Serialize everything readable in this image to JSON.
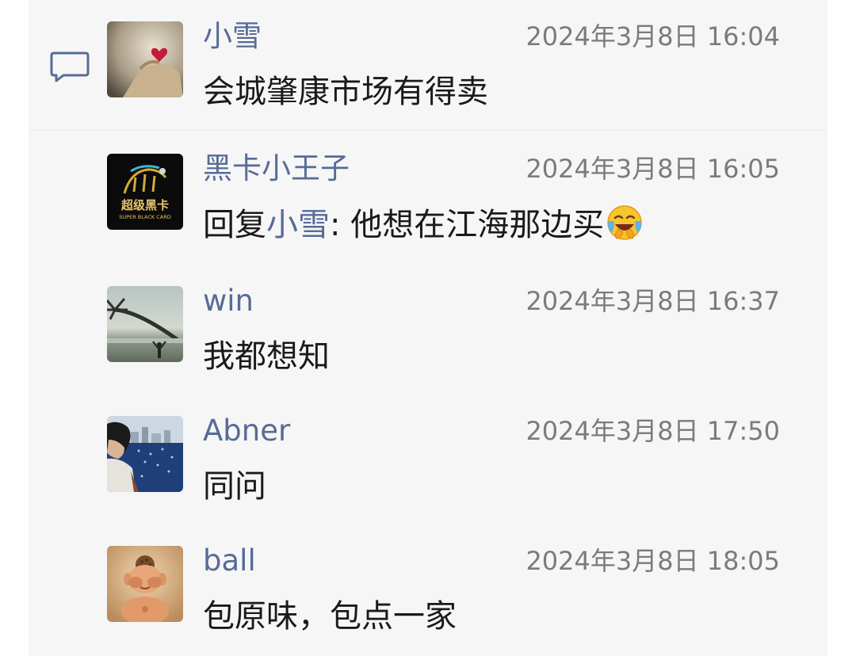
{
  "comments": [
    {
      "name": "小雪",
      "time": "2024年3月8日 16:04",
      "text": "会城肇康市场有得卖",
      "avatar_icon": "heart-finger-avatar"
    },
    {
      "name": "黑卡小王子",
      "time": "2024年3月8日 16:05",
      "reply_prefix": "回复",
      "reply_to": "小雪",
      "reply_sep": ": ",
      "text": "他想在江海那边买",
      "emoji_icon": "crying-laughing-emoji",
      "avatar_icon": "super-black-card-avatar",
      "avatar_logo_text": "超级黑卡",
      "avatar_logo_sub": "SUPER BLACK CARD"
    },
    {
      "name": "win",
      "time": "2024年3月8日 16:37",
      "text": "我都想知",
      "avatar_icon": "palm-tree-beach-avatar"
    },
    {
      "name": "Abner",
      "time": "2024年3月8日 17:50",
      "text": "同问",
      "avatar_icon": "person-by-lake-avatar"
    },
    {
      "name": "ball",
      "time": "2024年3月8日 18:05",
      "text": "包原味，包点一家",
      "avatar_icon": "buddha-figurine-avatar"
    }
  ],
  "colors": {
    "name": "#576b95",
    "panel_bg": "#f6f6f7",
    "time": "#7b7b7b",
    "text": "#1a1a1a"
  }
}
